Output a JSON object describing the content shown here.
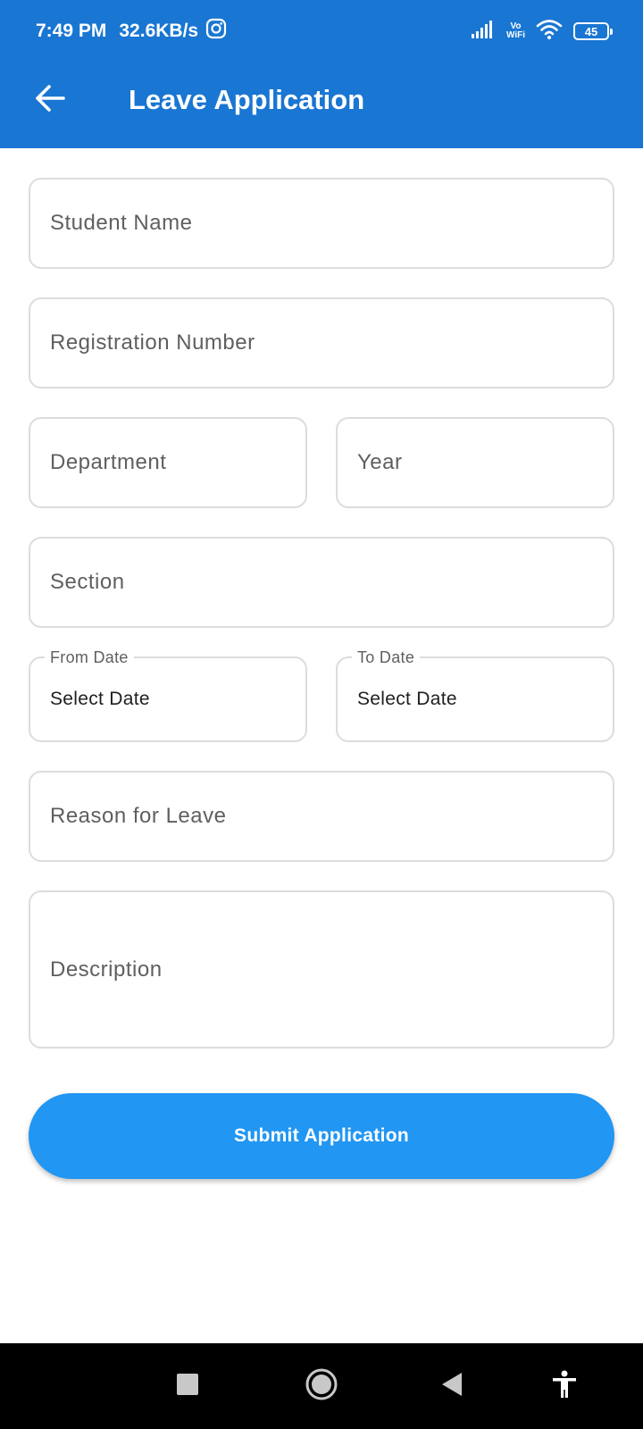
{
  "status_bar": {
    "time": "7:49 PM",
    "network_speed": "32.6KB/s",
    "vowifi_top": "Vo",
    "vowifi_bottom": "WiFi",
    "battery": "45"
  },
  "app_bar": {
    "title": "Leave Application",
    "back_icon": "arrow-left-icon"
  },
  "form": {
    "student_name": {
      "placeholder": "Student Name"
    },
    "registration_number": {
      "placeholder": "Registration Number"
    },
    "department": {
      "placeholder": "Department"
    },
    "year": {
      "placeholder": "Year"
    },
    "section": {
      "placeholder": "Section"
    },
    "from_date": {
      "label": "From Date",
      "value": "Select Date"
    },
    "to_date": {
      "label": "To Date",
      "value": "Select Date"
    },
    "reason": {
      "placeholder": "Reason for Leave"
    },
    "description": {
      "placeholder": "Description"
    },
    "submit_label": "Submit Application"
  },
  "colors": {
    "app_bar": "#1976D2",
    "button": "#2196F3",
    "field_border": "#dcdcdc"
  }
}
